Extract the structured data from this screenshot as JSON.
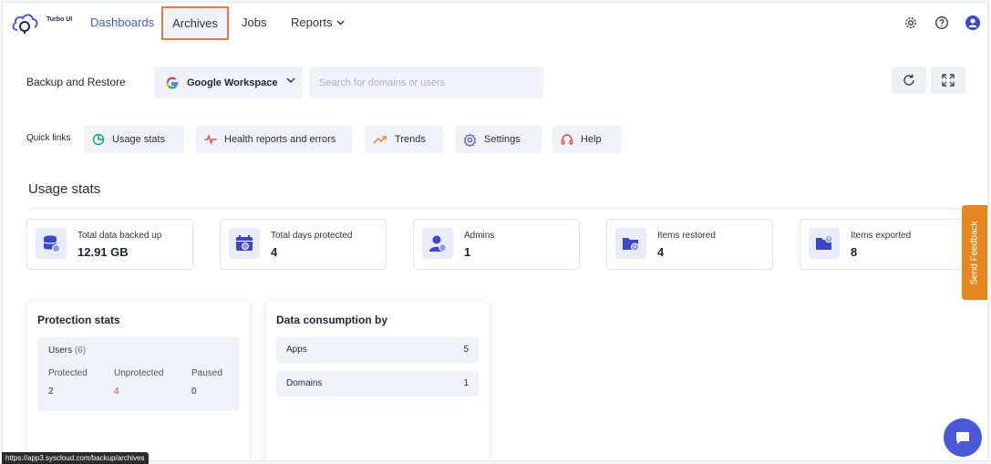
{
  "brand": {
    "name": "Turbo UI"
  },
  "nav": {
    "dashboards": "Dashboards",
    "archives": "Archives",
    "jobs": "Jobs",
    "reports": "Reports"
  },
  "backup": {
    "label": "Backup and Restore",
    "workspace": "Google Workspace",
    "search_placeholder": "Search for domains or users"
  },
  "quick_links": {
    "label": "Quick links",
    "items": [
      {
        "label": "Usage stats",
        "icon": "pie-chart-icon",
        "color": "#1aa87a"
      },
      {
        "label": "Health reports and errors",
        "icon": "pulse-icon",
        "color": "#e6454f"
      },
      {
        "label": "Trends",
        "icon": "trend-up-icon",
        "color": "#e6861f"
      },
      {
        "label": "Settings",
        "icon": "gear-icon",
        "color": "#4a57d6"
      },
      {
        "label": "Help",
        "icon": "headset-icon",
        "color": "#e6454f"
      }
    ]
  },
  "usage": {
    "title": "Usage stats",
    "stats": [
      {
        "label": "Total data backed up",
        "value": "12.91 GB",
        "icon": "database-icon"
      },
      {
        "label": "Total days protected",
        "value": "4",
        "icon": "calendar-icon"
      },
      {
        "label": "Admins",
        "value": "1",
        "icon": "admin-user-icon"
      },
      {
        "label": "Items restored",
        "value": "4",
        "icon": "folder-restore-icon"
      },
      {
        "label": "Items exported",
        "value": "8",
        "icon": "folder-export-icon"
      }
    ]
  },
  "feedback": {
    "label": "Send Feedback"
  },
  "protection": {
    "title": "Protection stats",
    "users_label": "Users",
    "users_count": "(6)",
    "protected_label": "Protected",
    "protected_value": "2",
    "unprotected_label": "Unprotected",
    "unprotected_value": "4",
    "paused_label": "Paused",
    "paused_value": "0"
  },
  "consumption": {
    "title": "Data consumption by",
    "rows": [
      {
        "label": "Apps",
        "value": "5"
      },
      {
        "label": "Domains",
        "value": "1"
      }
    ]
  },
  "status_url": "https://app3.syscloud.com/backup/archives",
  "colors": {
    "accent": "#4a57d6",
    "danger": "#e6454f",
    "feedback": "#e6861f",
    "highlight": "#e07a4a"
  }
}
